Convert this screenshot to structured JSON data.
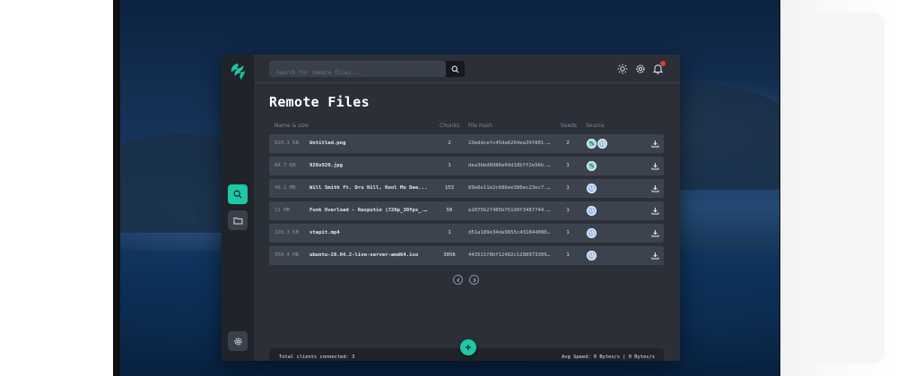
{
  "search": {
    "placeholder": "Search for remote files..."
  },
  "page": {
    "title": "Remote Files"
  },
  "table": {
    "headers": [
      "Name & size",
      "Chunks",
      "File Hash",
      "Seeds",
      "Source"
    ],
    "rows": [
      {
        "size": "820.1 KB",
        "name": "Untitled.png",
        "chunks": "2",
        "hash": "23eddcefc45da6264ea39f801...",
        "seeds": "2",
        "sources": [
          "seed-globe-icon",
          "client-globe-icon"
        ]
      },
      {
        "size": "84.7 KB",
        "name": "920x920.jpg",
        "chunks": "1",
        "hash": "dea3bbd8986e04d18b7f2e96b...",
        "seeds": "1",
        "sources": [
          "seed-globe-icon"
        ]
      },
      {
        "size": "46.1 MB",
        "name": "Will Smith ft. Dru Hill, Kool Mo Dee...",
        "chunks": "153",
        "hash": "89e6e11e2c686ee386ec23ec7...",
        "seeds": "1",
        "sources": [
          "client-globe-icon"
        ]
      },
      {
        "size": "11 MB",
        "name": "Funk Overload - Rasputin (720p_30fps_...",
        "chunks": "50",
        "hash": "a1075b27485bf51d9f3487744...",
        "seeds": "1",
        "sources": [
          "client-globe-icon"
        ]
      },
      {
        "size": "228.3 KB",
        "name": "stapit.mp4",
        "chunks": "1",
        "hash": "d51a189e34da9655c431844080...",
        "seeds": "1",
        "sources": [
          "client-globe-icon"
        ]
      },
      {
        "size": "958.4 MB",
        "name": "ubuntu-20.04.2-live-server-amd64.iso",
        "chunks": "3056",
        "hash": "443511f0bf12482c1298973309...",
        "seeds": "1",
        "sources": [
          "client-globe-icon"
        ]
      }
    ]
  },
  "footer": {
    "clients": "Total clients connected: 3",
    "speed": "Avg Speed: 0 Bytes/s | 0 Bytes/s"
  },
  "colors": {
    "accent": "#1fc7a6",
    "panel": "#2a2f38",
    "row": "#3d434e",
    "sidebar": "#1f232a",
    "notification": "#e53935"
  }
}
